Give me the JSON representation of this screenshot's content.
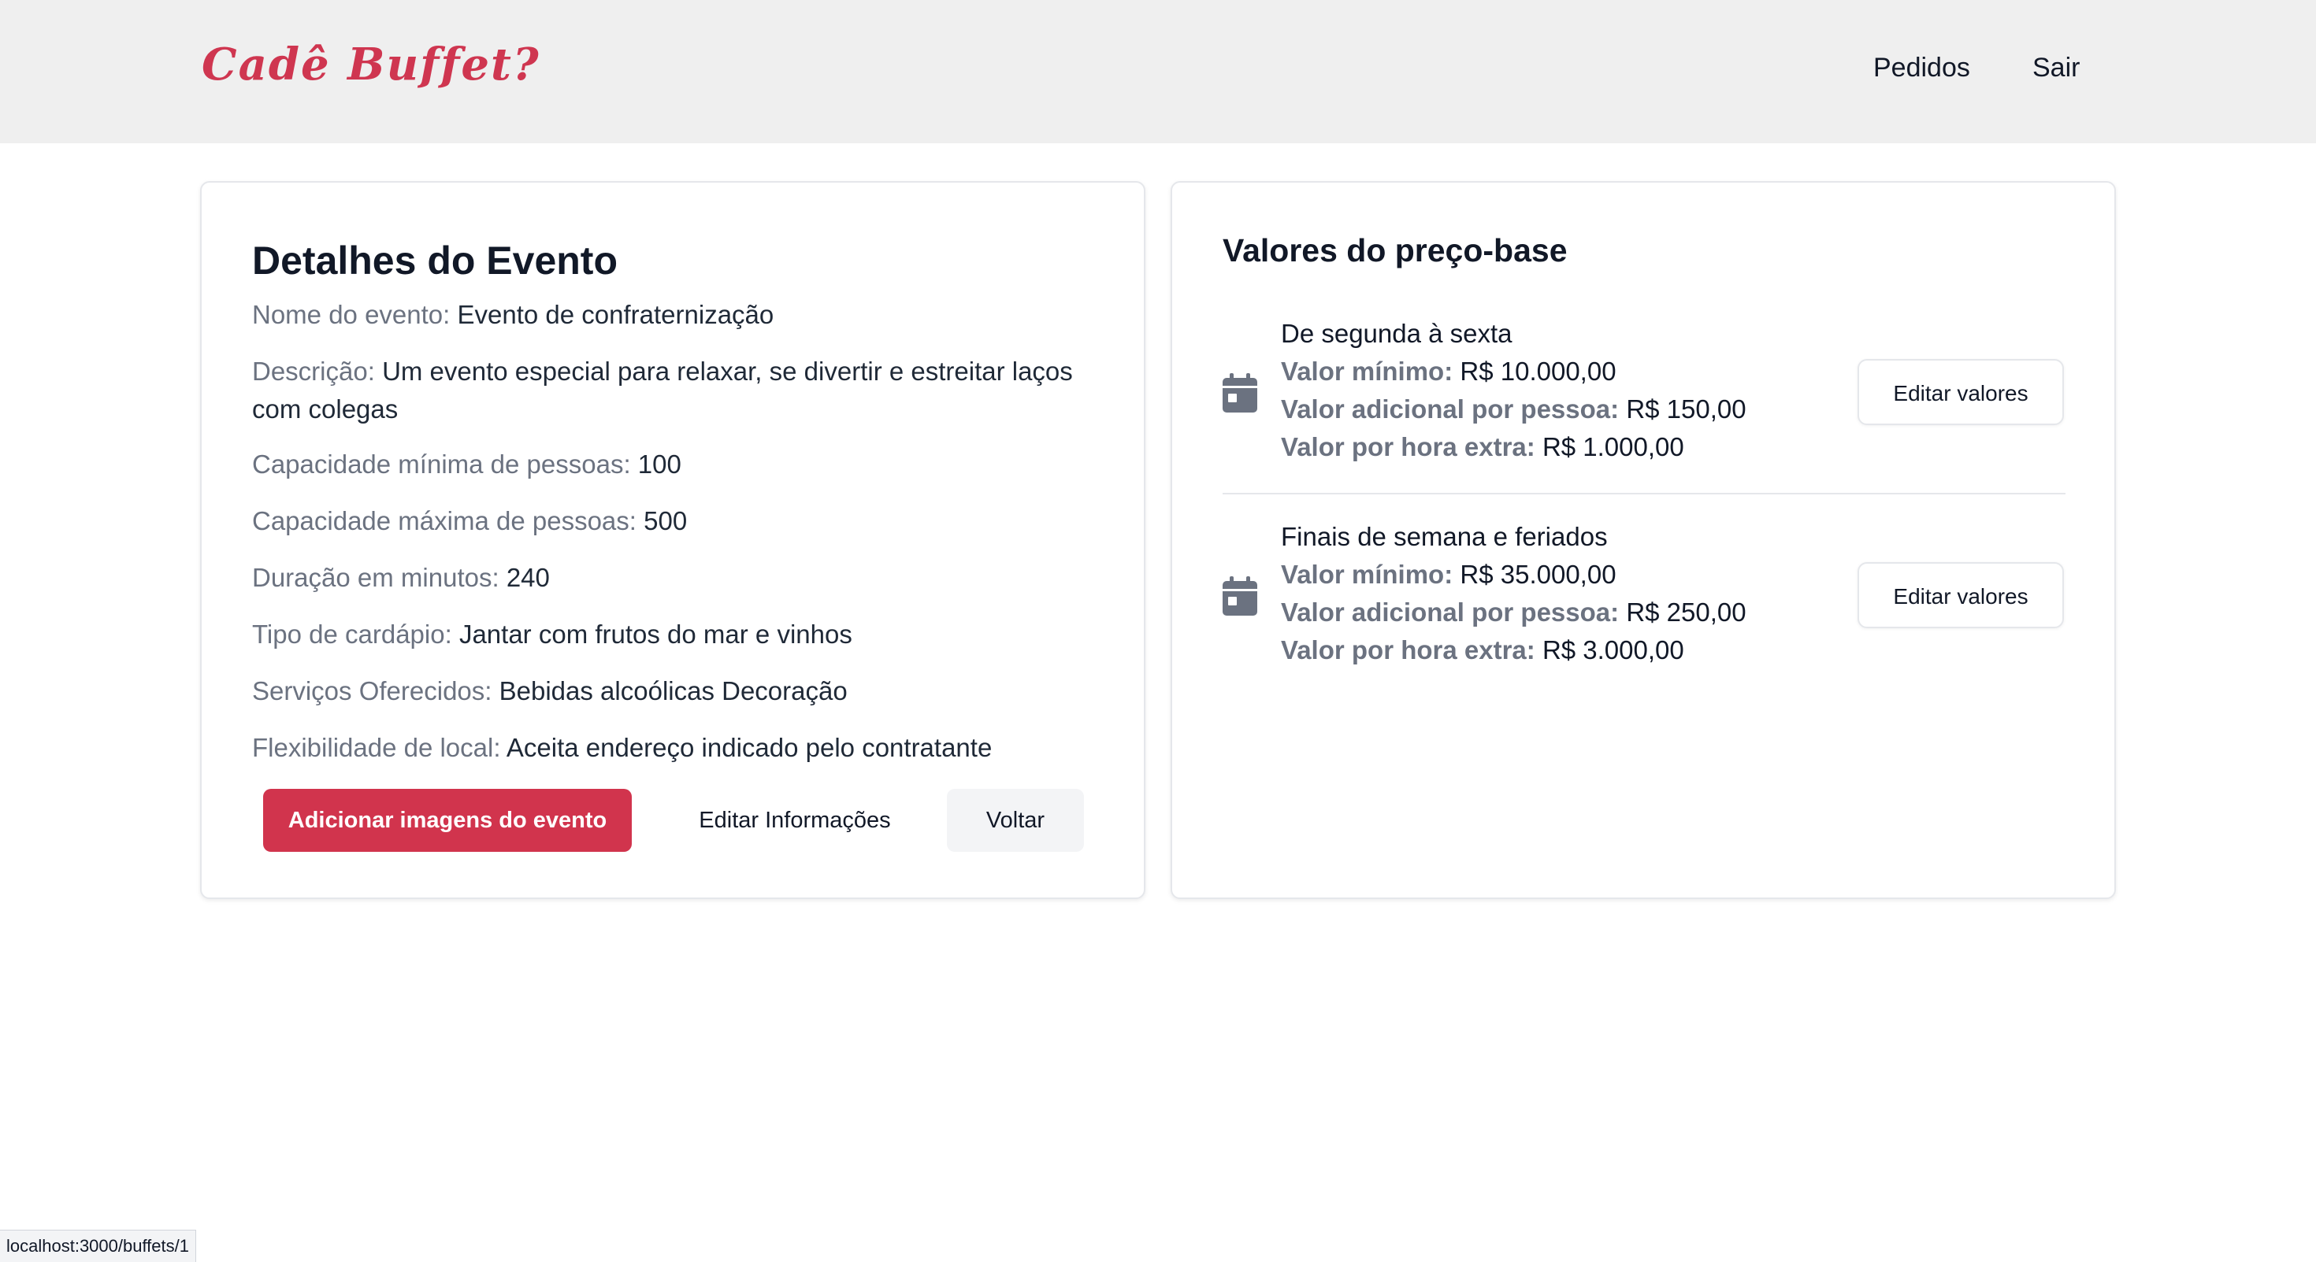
{
  "header": {
    "logo_text": "Cadê Buffet?",
    "nav": [
      {
        "label": "Pedidos"
      },
      {
        "label": "Sair"
      }
    ]
  },
  "event": {
    "title": "Detalhes do Evento",
    "details": [
      {
        "label": "Nome do evento:",
        "value": "Evento de confraternização"
      },
      {
        "label": "Descrição:",
        "value": "Um evento especial para relaxar, se divertir e estreitar laços com colegas"
      },
      {
        "label": "Capacidade mínima de pessoas:",
        "value": "100"
      },
      {
        "label": "Capacidade máxima de pessoas:",
        "value": "500"
      },
      {
        "label": "Duração em minutos:",
        "value": "240"
      },
      {
        "label": "Tipo de cardápio:",
        "value": "Jantar com frutos do mar e vinhos"
      },
      {
        "label": "Serviços Oferecidos:",
        "value": "Bebidas alcoólicas Decoração"
      },
      {
        "label": "Flexibilidade de local:",
        "value": "Aceita endereço indicado pelo contratante"
      }
    ],
    "actions": {
      "add_images": "Adicionar imagens do evento",
      "edit_info": "Editar Informações",
      "back": "Voltar"
    }
  },
  "prices": {
    "title": "Valores do preço-base",
    "periods": [
      {
        "name": "De segunda à sexta",
        "min_label": "Valor mínimo:",
        "min_value": "R$ 10.000,00",
        "per_person_label": "Valor adicional por pessoa:",
        "per_person_value": "R$ 150,00",
        "extra_hour_label": "Valor por hora extra:",
        "extra_hour_value": "R$ 1.000,00",
        "edit_label": "Editar valores",
        "icon": "calendar-icon"
      },
      {
        "name": "Finais de semana e feriados",
        "min_label": "Valor mínimo:",
        "min_value": "R$ 35.000,00",
        "per_person_label": "Valor adicional por pessoa:",
        "per_person_value": "R$ 250,00",
        "extra_hour_label": "Valor por hora extra:",
        "extra_hour_value": "R$ 3.000,00",
        "edit_label": "Editar valores",
        "icon": "calendar-icon"
      }
    ]
  },
  "statusbar": {
    "url": "localhost:3000/buffets/1"
  },
  "colors": {
    "brand": "#cf3650",
    "primary_button": "#d1344d",
    "header_bg": "#efefef",
    "label_gray": "#6b7280"
  }
}
